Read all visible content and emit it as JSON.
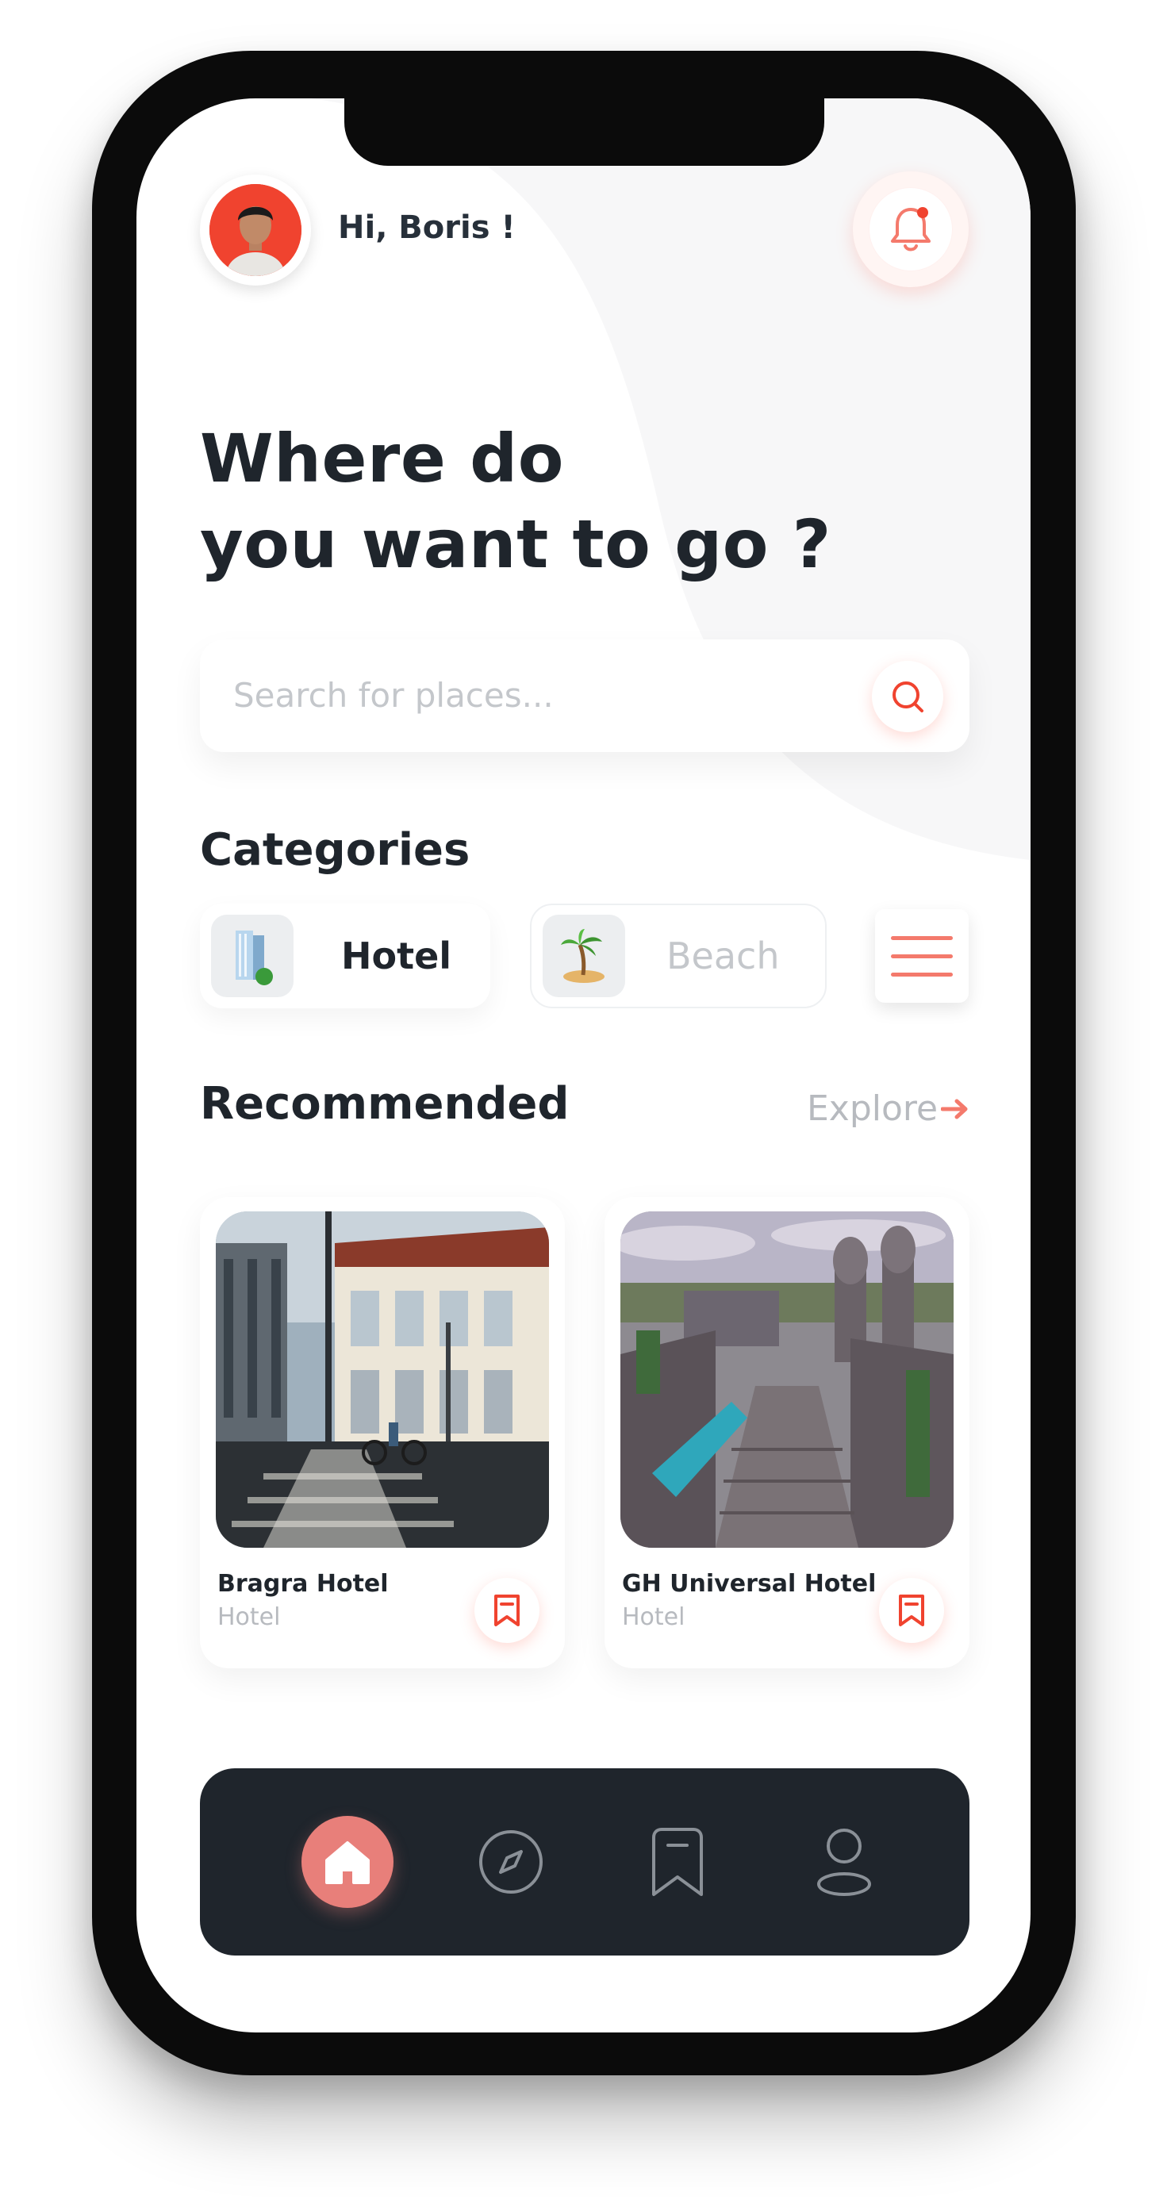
{
  "header": {
    "greeting": "Hi, Boris !"
  },
  "hero": {
    "line1": "Where do",
    "line2": "you want to go ?"
  },
  "search": {
    "placeholder": "Search for places..."
  },
  "categories": {
    "title": "Categories",
    "items": [
      {
        "label": "Hotel",
        "icon": "hotel-building-icon",
        "selected": true
      },
      {
        "label": "Beach",
        "icon": "palm-tree-icon",
        "selected": false
      }
    ]
  },
  "recommended": {
    "title": "Recommended",
    "explore_label": "Explore",
    "cards": [
      {
        "name": "Bragra Hotel",
        "type": "Hotel"
      },
      {
        "name": "GH Universal Hotel",
        "type": "Hotel"
      }
    ]
  },
  "nav": {
    "items": [
      "home-icon",
      "compass-icon",
      "bookmark-icon",
      "profile-icon"
    ],
    "active": "home-icon"
  },
  "colors": {
    "accent": "#f47a6c",
    "dark": "#1f252c",
    "muted": "#c4c7cb",
    "home_bubble": "#e87f7a"
  }
}
